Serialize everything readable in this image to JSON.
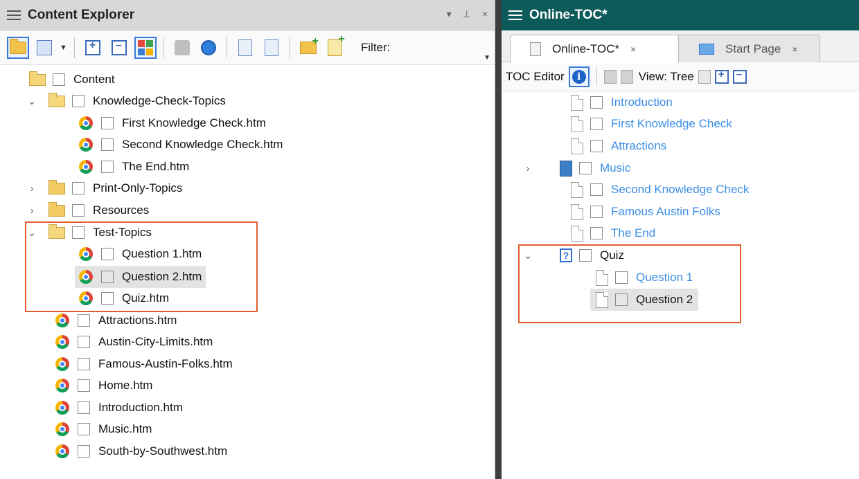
{
  "left_panel": {
    "title": "Content Explorer",
    "controls": {
      "dropdown": "▾",
      "pin": "⊥",
      "close": "×"
    },
    "toolbar": {
      "filter_label": "Filter:"
    },
    "tree": {
      "root": "Content",
      "folders": [
        {
          "label": "Knowledge-Check-Topics",
          "expanded": true,
          "files": [
            "First Knowledge Check.htm",
            "Second Knowledge Check.htm",
            "The End.htm"
          ]
        },
        {
          "label": "Print-Only-Topics",
          "expanded": false
        },
        {
          "label": "Resources",
          "expanded": false
        },
        {
          "label": "Test-Topics",
          "expanded": true,
          "files": [
            "Question 1.htm",
            "Question 2.htm",
            "Quiz.htm"
          ]
        }
      ],
      "files": [
        "Attractions.htm",
        "Austin-City-Limits.htm",
        "Famous-Austin-Folks.htm",
        "Home.htm",
        "Introduction.htm",
        "Music.htm",
        "South-by-Southwest.htm"
      ]
    }
  },
  "right_panel": {
    "title": "Online-TOC*",
    "tabs": [
      {
        "label": "Online-TOC*",
        "close": "×",
        "active": true
      },
      {
        "label": "Start Page",
        "close": "×",
        "active": false
      }
    ],
    "toolbar": {
      "editor_label": "TOC Editor",
      "info": "i",
      "view_label": "View: Tree"
    },
    "toc": {
      "items": [
        "Introduction",
        "First Knowledge Check",
        "Attractions",
        "Music",
        "Second Knowledge Check",
        "Famous Austin Folks",
        "The End"
      ],
      "quiz": {
        "label": "Quiz",
        "quiz_icon": "?",
        "children": [
          "Question 1",
          "Question 2"
        ]
      }
    }
  },
  "colors": {
    "highlight": "#e35a2b",
    "link": "#3a8ee6",
    "title_bar_right": "#0c5a59"
  }
}
